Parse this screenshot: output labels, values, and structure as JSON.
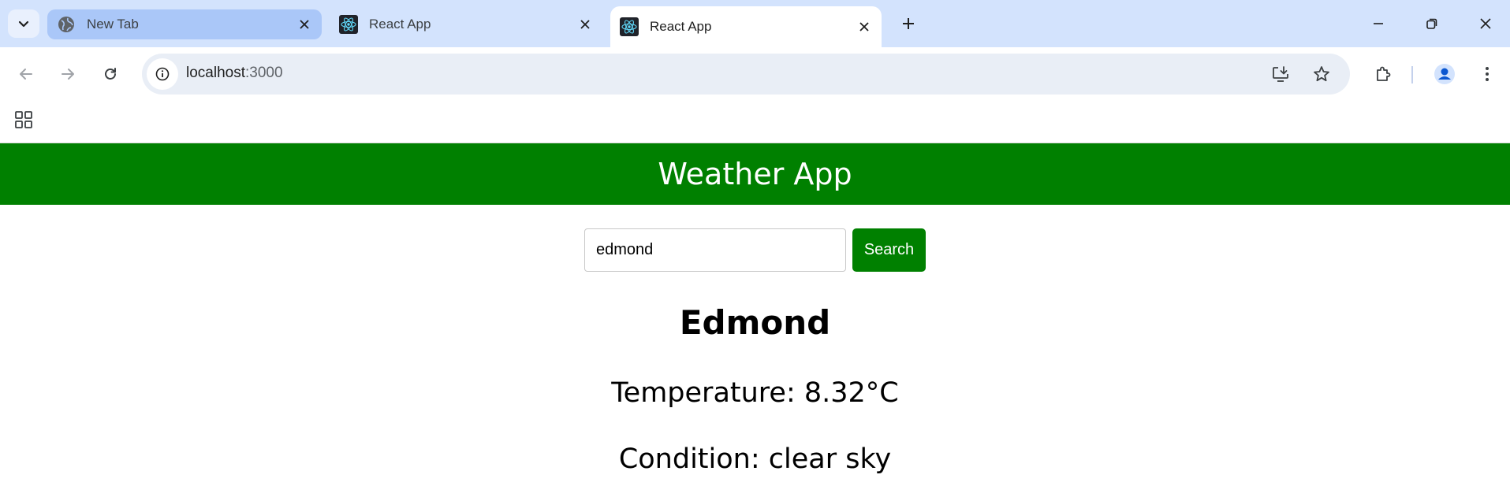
{
  "browser": {
    "tabs": [
      {
        "title": "New Tab",
        "icon": "globe-icon",
        "active": false
      },
      {
        "title": "React App",
        "icon": "react-logo-icon",
        "active": false
      },
      {
        "title": "React App",
        "icon": "react-logo-icon",
        "active": true
      }
    ],
    "address": {
      "host": "localhost",
      "port": ":3000"
    },
    "colors": {
      "tabstrip": "#d3e3fd",
      "omnibox": "#e9eef6"
    }
  },
  "app": {
    "title": "Weather App",
    "search": {
      "value": "edmond",
      "button_label": "Search"
    },
    "result": {
      "city": "Edmond",
      "temperature": "Temperature: 8.32°C",
      "condition": "Condition: clear sky"
    },
    "colors": {
      "header_bg": "#008000",
      "button_bg": "#008000"
    }
  }
}
